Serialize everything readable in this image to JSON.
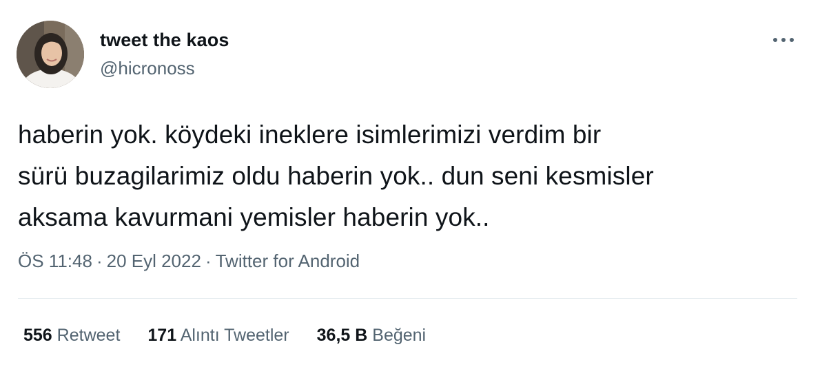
{
  "user": {
    "display_name": "tweet the kaos",
    "handle": "@hicronoss",
    "avatar_icon": "profile-photo"
  },
  "more_icon": "more-options-icon",
  "tweet": {
    "text": "haberin yok. köydeki ineklere isimlerimizi verdim bir\nsürü buzagilarimiz oldu haberin yok.. dun seni kesmisler\naksama kavurmani yemisler haberin yok.."
  },
  "meta": {
    "time": "ÖS 11:48",
    "separator": "·",
    "date": "20 Eyl 2022",
    "source": "Twitter for Android"
  },
  "stats": {
    "retweets": {
      "count": "556",
      "label": "Retweet"
    },
    "quotes": {
      "count": "171",
      "label": "Alıntı Tweetler"
    },
    "likes": {
      "count": "36,5 B",
      "label": "Beğeni"
    }
  },
  "colors": {
    "text_primary": "#0f1419",
    "text_secondary": "#536471",
    "divider": "#e6ecf0"
  }
}
